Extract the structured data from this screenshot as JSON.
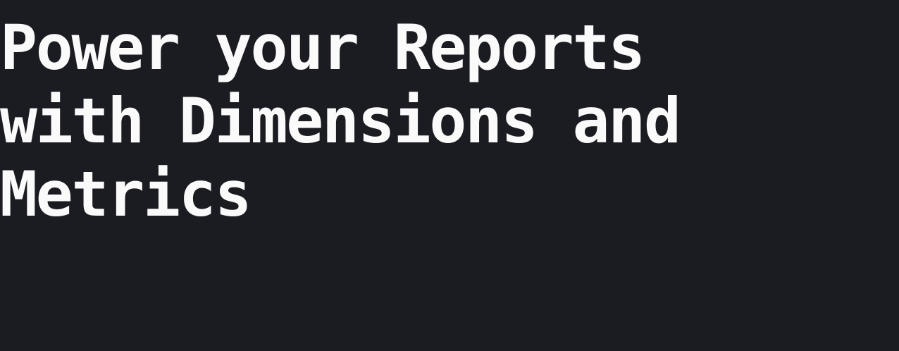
{
  "hero": {
    "headline_lines": [
      "Power your Reports",
      "with Dimensions and",
      "Metrics"
    ]
  },
  "colors": {
    "background": "#1b1c21",
    "text": "#fafafa"
  }
}
